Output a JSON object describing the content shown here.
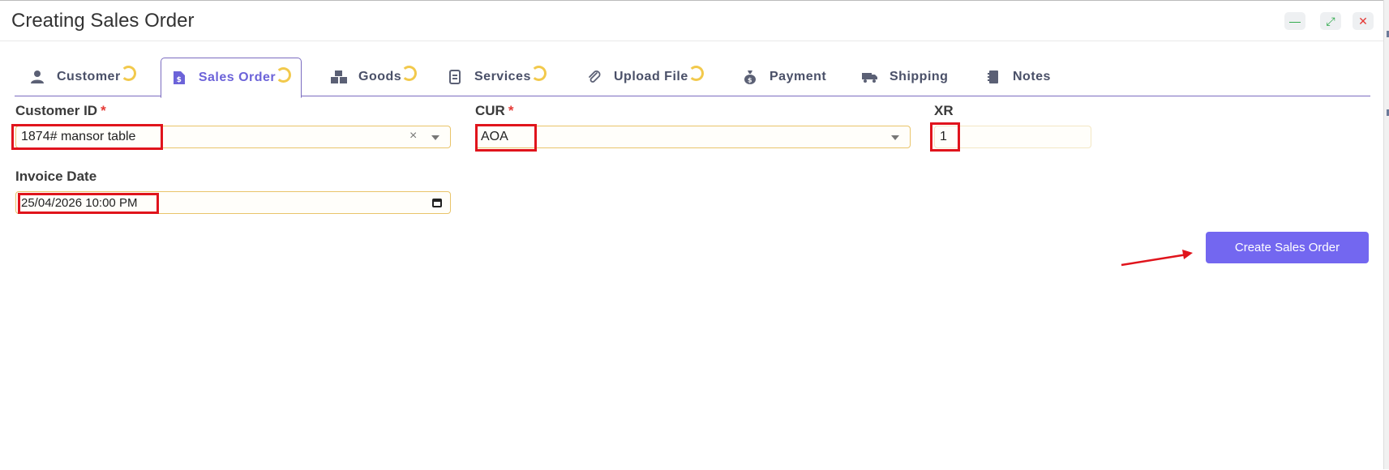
{
  "window": {
    "title": "Creating Sales Order",
    "minimize_symbol": "—",
    "maximize_symbol": "⤢",
    "close_symbol": "✕"
  },
  "tabs": [
    {
      "label": "Customer",
      "icon": "user-icon",
      "loading": true
    },
    {
      "label": "Sales Order",
      "icon": "invoice-icon",
      "loading": true,
      "active": true
    },
    {
      "label": "Goods",
      "icon": "boxes-icon",
      "loading": true
    },
    {
      "label": "Services",
      "icon": "document-icon",
      "loading": true
    },
    {
      "label": "Upload File",
      "icon": "paperclip-icon",
      "loading": true
    },
    {
      "label": "Payment",
      "icon": "money-bag-icon",
      "loading": false
    },
    {
      "label": "Shipping",
      "icon": "truck-icon",
      "loading": false
    },
    {
      "label": "Notes",
      "icon": "notebook-icon",
      "loading": false
    }
  ],
  "form": {
    "customer_id": {
      "label": "Customer ID",
      "required": "*",
      "value": "1874# mansor table",
      "clear": "×"
    },
    "cur": {
      "label": "CUR",
      "required": "*",
      "value": "AOA"
    },
    "xr": {
      "label": "XR",
      "value": "1"
    },
    "invoice_date": {
      "label": "Invoice Date",
      "value": "25/04/2026 10:00  PM"
    }
  },
  "actions": {
    "create_label": "Create Sales Order"
  },
  "colors": {
    "accent": "#7367f0",
    "highlight": "#e0141c",
    "field_border": "#e9c46a",
    "spinner": "#f2c94c"
  }
}
